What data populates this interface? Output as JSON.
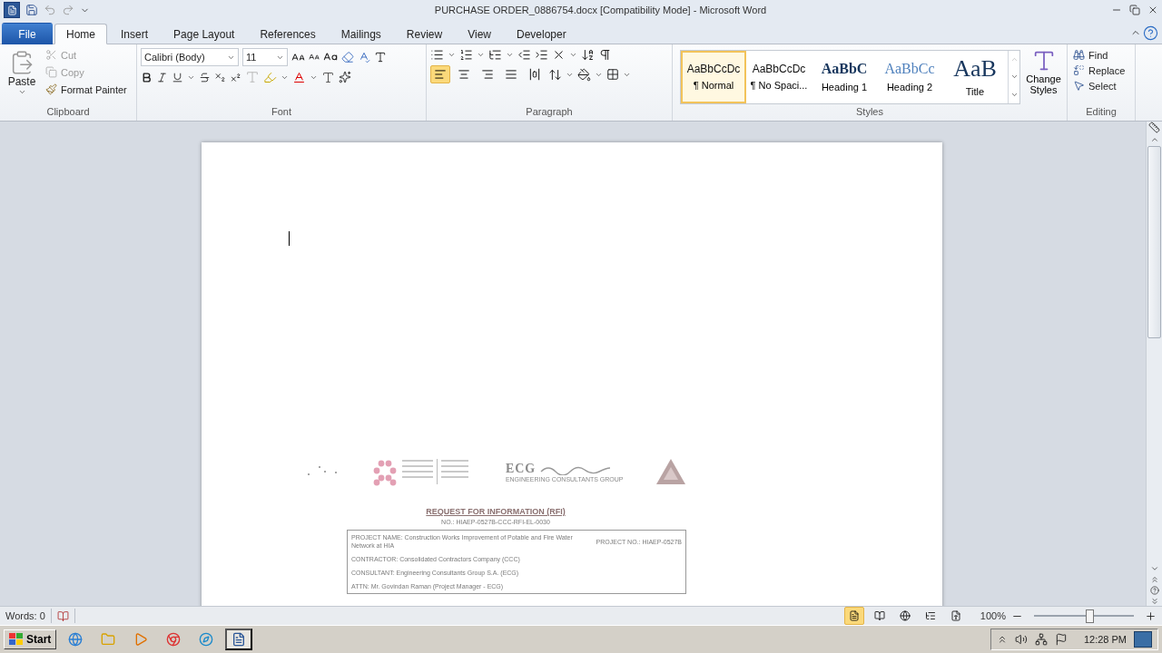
{
  "window": {
    "title": "PURCHASE ORDER_0886754.docx [Compatibility Mode]  -  Microsoft Word"
  },
  "tabs": [
    {
      "label": "File",
      "selected": false,
      "kind": "file"
    },
    {
      "label": "Home",
      "selected": true,
      "kind": "tab"
    },
    {
      "label": "Insert",
      "selected": false,
      "kind": "tab"
    },
    {
      "label": "Page Layout",
      "selected": false,
      "kind": "tab"
    },
    {
      "label": "References",
      "selected": false,
      "kind": "tab"
    },
    {
      "label": "Mailings",
      "selected": false,
      "kind": "tab"
    },
    {
      "label": "Review",
      "selected": false,
      "kind": "tab"
    },
    {
      "label": "View",
      "selected": false,
      "kind": "tab"
    },
    {
      "label": "Developer",
      "selected": false,
      "kind": "tab"
    }
  ],
  "clipboard": {
    "label": "Clipboard",
    "paste": "Paste",
    "items": [
      {
        "label": "Cut",
        "disabled": true,
        "kind": "cut"
      },
      {
        "label": "Copy",
        "disabled": true,
        "kind": "copy"
      },
      {
        "label": "Format Painter",
        "disabled": false,
        "kind": "painter"
      }
    ]
  },
  "font": {
    "label": "Font",
    "font_name": "Calibri (Body)",
    "font_size": "11"
  },
  "paragraph": {
    "label": "Paragraph",
    "alignments": [
      {
        "selected": true
      },
      {
        "selected": false
      },
      {
        "selected": false
      },
      {
        "selected": false
      },
      {
        "selected": false
      }
    ]
  },
  "styles": {
    "label": "Styles",
    "change_styles": "Change Styles",
    "gallery": [
      {
        "preview": "AaBbCcDc",
        "name": "¶ Normal",
        "selected": true,
        "kind": "plain"
      },
      {
        "preview": "AaBbCcDc",
        "name": "¶ No Spaci...",
        "selected": false,
        "kind": "plain"
      },
      {
        "preview": "AaBbC",
        "name": "Heading 1",
        "selected": false,
        "kind": "heading1"
      },
      {
        "preview": "AaBbCc",
        "name": "Heading 2",
        "selected": false,
        "kind": "heading2"
      },
      {
        "preview": "AaB",
        "name": "Title",
        "selected": false,
        "kind": "title"
      }
    ]
  },
  "editing": {
    "label": "Editing",
    "items": [
      {
        "label": "Find",
        "kind": "find"
      },
      {
        "label": "Replace",
        "kind": "replace"
      },
      {
        "label": "Select",
        "kind": "select"
      }
    ]
  },
  "document": {
    "scan": {
      "logo_text": "ECG",
      "logo_caption": "ENGINEERING CONSULTANTS GROUP",
      "heading": "REQUEST FOR INFORMATION (RFI)",
      "number": "NO.: HIAEP-0527B-CCC-RFI-EL-0030",
      "project_name": "PROJECT NAME: Construction Works Improvement of Potable and Fire Water Network at HIA",
      "project_no": "PROJECT NO.: HIAEP-0527B",
      "rows": [
        "CONTRACTOR: Consolidated Contractors Company (CCC)",
        "CONSULTANT:  Engineering Consultants Group S.A. (ECG)",
        "ATTN: Mr. Govindan Raman (Project Manager - ECG)"
      ]
    }
  },
  "status_bar": {
    "words": "Words: 0",
    "zoom": "100%",
    "level": 0.55,
    "views": [
      {
        "selected": true
      },
      {
        "selected": false
      },
      {
        "selected": false
      },
      {
        "selected": false
      },
      {
        "selected": false
      }
    ]
  },
  "taskbar": {
    "start": "Start",
    "clock": "12:28 PM"
  }
}
